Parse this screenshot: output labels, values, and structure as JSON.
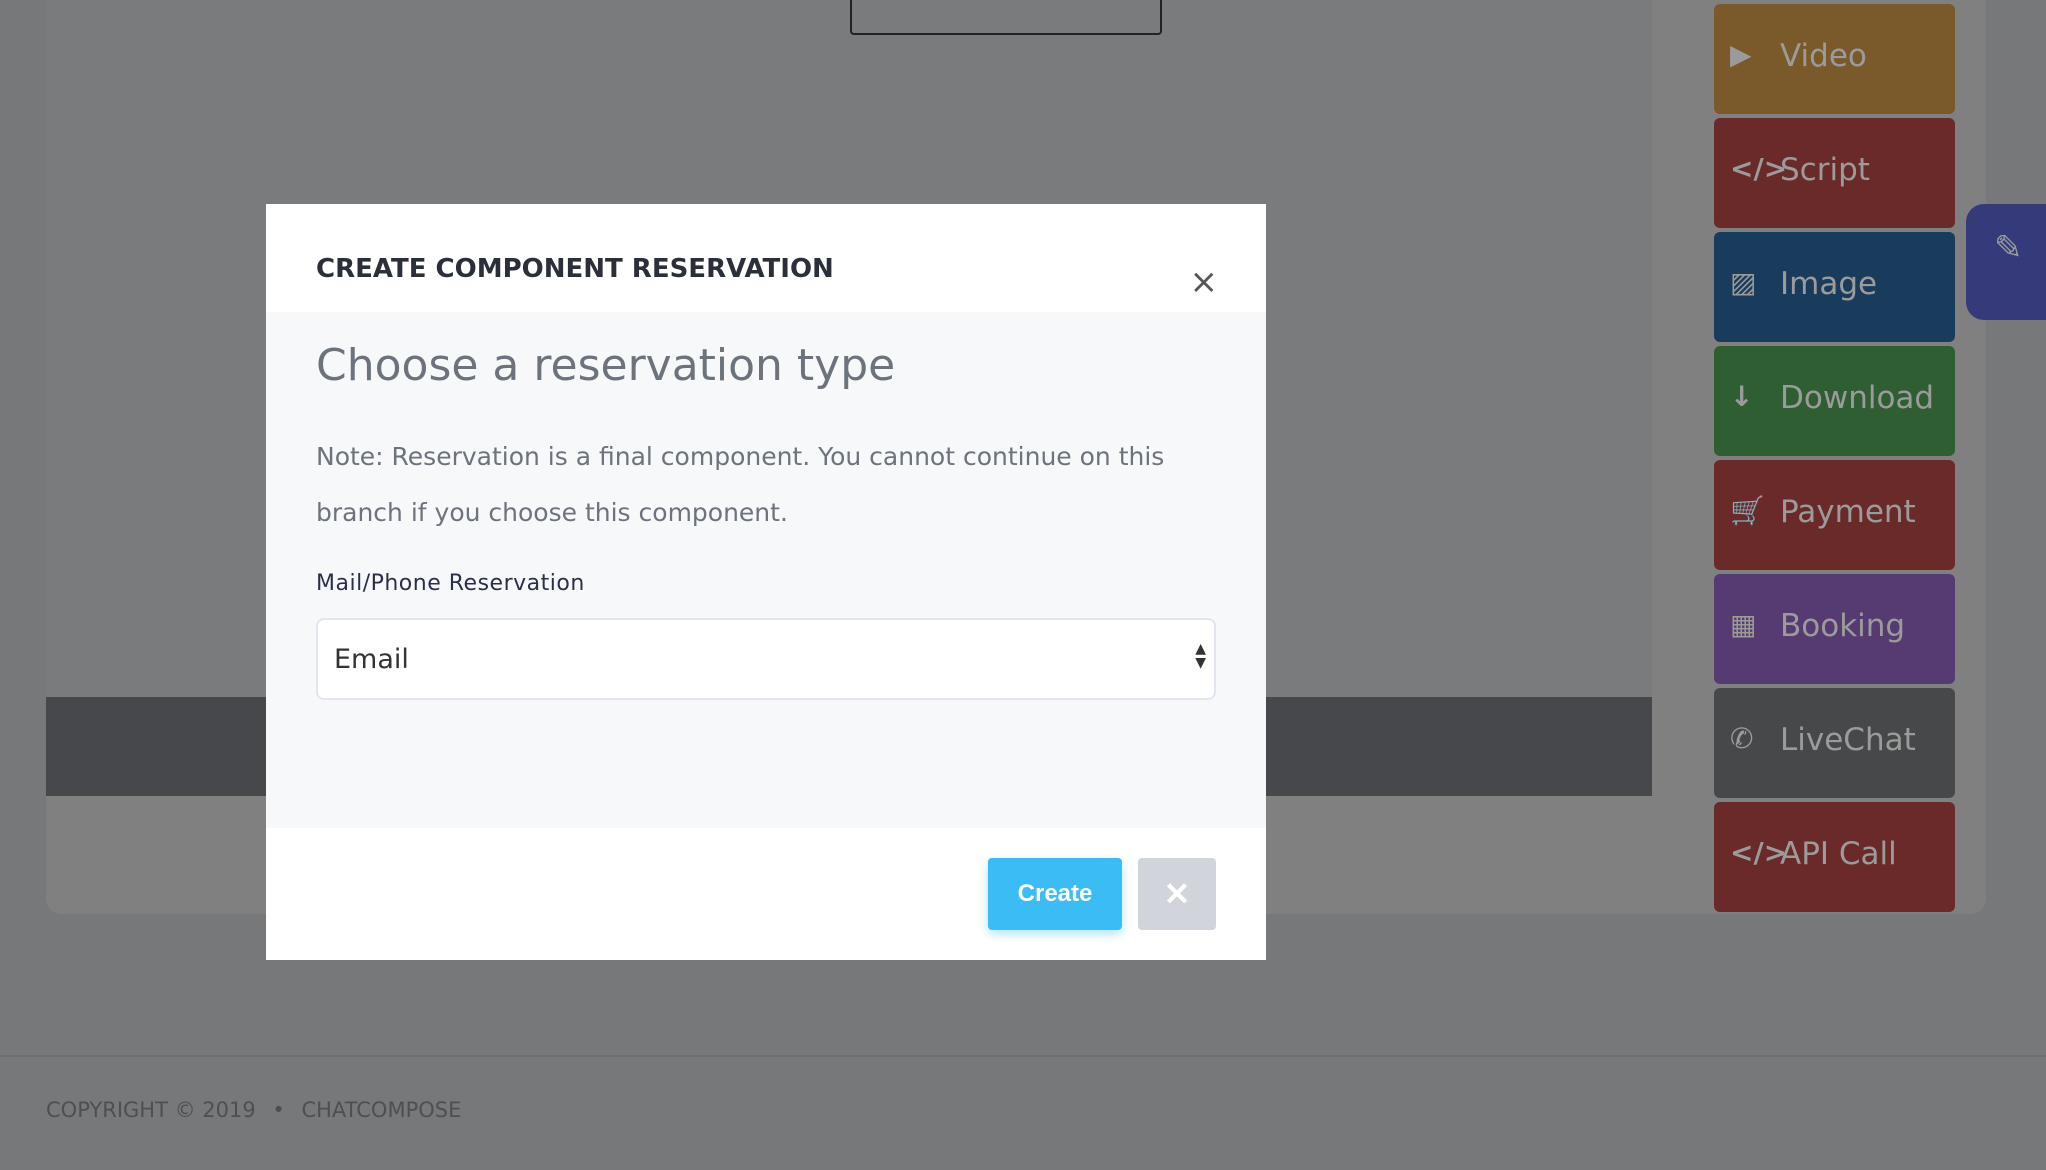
{
  "components": [
    {
      "label": "Video",
      "icon": "play-icon",
      "glyph": "▶",
      "color": "#7a5a2a"
    },
    {
      "label": "Script",
      "icon": "code-icon",
      "glyph": "</>",
      "color": "#6b2a2a"
    },
    {
      "label": "Image",
      "icon": "image-icon",
      "glyph": "▨",
      "color": "#1a3c5c"
    },
    {
      "label": "Download",
      "icon": "arrow-down-icon",
      "glyph": "↓",
      "color": "#2f5e32"
    },
    {
      "label": "Payment",
      "icon": "cart-icon",
      "glyph": "🛒",
      "color": "#6b2a2a"
    },
    {
      "label": "Booking",
      "icon": "calendar-icon",
      "glyph": "▦",
      "color": "#563a72"
    },
    {
      "label": "LiveChat",
      "icon": "phone-icon",
      "glyph": "✆",
      "color": "#474849"
    },
    {
      "label": "API Call",
      "icon": "code-icon",
      "glyph": "</>",
      "color": "#6b2a2a"
    }
  ],
  "edit_icon": "✎",
  "footer": {
    "copyright": "COPYRIGHT © 2019",
    "separator": "•",
    "brand": "CHATCOMPOSE"
  },
  "modal": {
    "title": "CREATE COMPONENT RESERVATION",
    "close": "×",
    "heading": "Choose a reservation type",
    "note": "Note: Reservation is a final component. You cannot continue on this branch if you choose this component.",
    "field_label": "Mail/Phone Reservation",
    "select_value": "Email",
    "create_label": "Create",
    "cancel_label": "✕"
  }
}
